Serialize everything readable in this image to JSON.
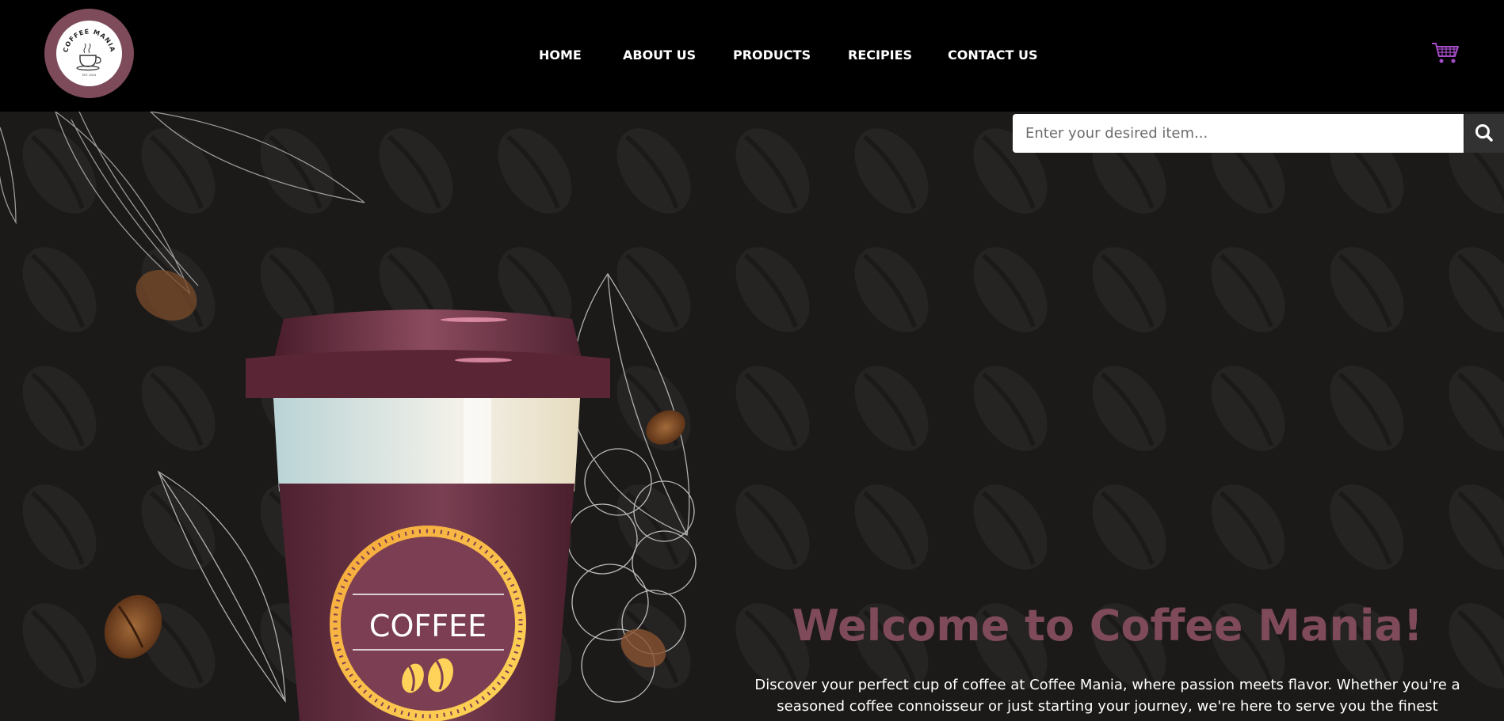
{
  "brand": {
    "logo_ring_text": "COFFEE MANIA",
    "logo_sub_text": "EST. 2024",
    "logo_color": "#7d4b5a"
  },
  "nav": {
    "items": [
      {
        "label": "HOME"
      },
      {
        "label": "ABOUT US"
      },
      {
        "label": "PRODUCTS"
      },
      {
        "label": "RECIPIES"
      },
      {
        "label": "CONTACT US"
      }
    ]
  },
  "cart": {
    "icon": "shopping-cart-icon",
    "color": "#a64dc9"
  },
  "search": {
    "placeholder": "Enter your desired item...",
    "value": "",
    "icon": "search-icon"
  },
  "hero": {
    "title": "Welcome to Coffee Mania!",
    "description": "Discover your perfect cup of coffee at Coffee Mania, where passion meets flavor. Whether you're a seasoned coffee connoisseur or just starting your journey, we're here to serve you the finest blends and brews.",
    "cup_label": "COFFEE",
    "accent_color": "#7f4a5a",
    "background_color": "#1b1a19"
  }
}
